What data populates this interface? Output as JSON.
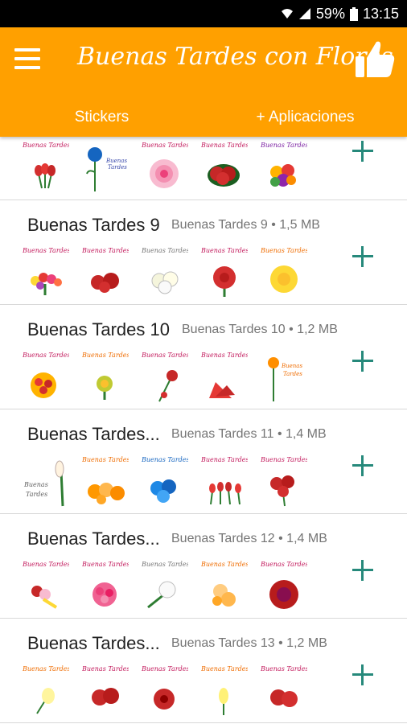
{
  "status_bar": {
    "battery": "59%",
    "time": "13:15"
  },
  "app_bar": {
    "title": "Buenas Tardes con Flores"
  },
  "tabs": [
    {
      "label": "Stickers"
    },
    {
      "label": "+ Aplicaciones"
    }
  ],
  "sticker_caption": "Buenas Tardes",
  "colors": {
    "primary": "#ffa000",
    "accent": "#26897b"
  },
  "packs": [
    {
      "name": "",
      "meta": ""
    },
    {
      "name": "Buenas Tardes 9",
      "meta": "Buenas Tardes 9 • 1,5 MB"
    },
    {
      "name": "Buenas Tardes 10",
      "meta": "Buenas Tardes 10 • 1,2 MB"
    },
    {
      "name": "Buenas Tardes...",
      "meta": "Buenas Tardes 11 • 1,4 MB"
    },
    {
      "name": "Buenas Tardes...",
      "meta": "Buenas Tardes 12 • 1,4 MB"
    },
    {
      "name": "Buenas Tardes...",
      "meta": "Buenas Tardes 13 • 1,2 MB"
    }
  ]
}
